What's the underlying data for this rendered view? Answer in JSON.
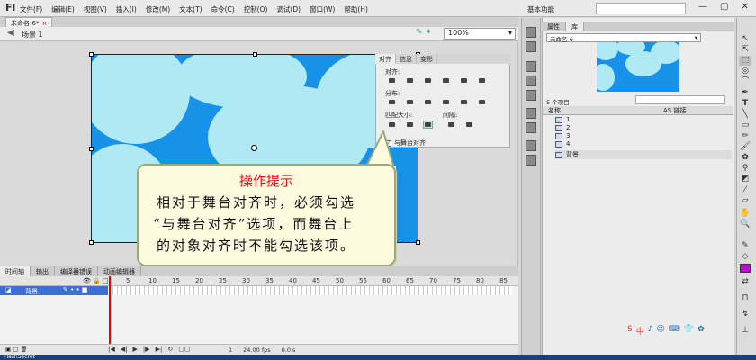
{
  "app": {
    "logo": "Fl",
    "workspace": "基本功能",
    "window_buttons": [
      "—",
      "▢",
      "✕"
    ]
  },
  "menus": [
    "文件(F)",
    "编辑(E)",
    "视图(V)",
    "插入(I)",
    "修改(M)",
    "文本(T)",
    "命令(C)",
    "控制(O)",
    "调试(D)",
    "窗口(W)",
    "帮助(H)"
  ],
  "document": {
    "tab": "未命名-6*",
    "tab_close": "×",
    "scene": "场景 1",
    "zoom": "100%"
  },
  "align_panel": {
    "tabs": [
      "对齐",
      "信息",
      "变形"
    ],
    "sections": {
      "align": "对齐:",
      "distribute": "分布:",
      "match_size": "匹配大小:",
      "spacing": "间隔:"
    },
    "stage_checkbox": "与舞台对齐",
    "stage_checked": true
  },
  "hint": {
    "title": "操作提示",
    "lines": [
      "相对于舞台对齐时，必须勾选",
      "“与舞台对齐”选项，而舞台上",
      "的对象对齐时不能勾选该项。"
    ]
  },
  "timeline": {
    "tabs": [
      "时间轴",
      "输出",
      "编译器错误",
      "动画编辑器"
    ],
    "ticks": [
      "5",
      "10",
      "15",
      "20",
      "25",
      "30",
      "35",
      "40",
      "45",
      "50",
      "55",
      "60",
      "65",
      "70",
      "75",
      "80",
      "85"
    ],
    "layer": "背景",
    "frame": "1",
    "fps": "24.00 fps",
    "time": "0.0 s"
  },
  "library": {
    "tabs": [
      "属性",
      "库"
    ],
    "doc": "未命名-6",
    "count": "5 个项目",
    "columns": [
      "名称",
      "AS 链接"
    ],
    "items": [
      "1",
      "2",
      "3",
      "4",
      "背景"
    ]
  },
  "ime_tray": [
    "S",
    "中",
    "♪",
    "☺",
    "⌨",
    "👕",
    "✿"
  ],
  "status": "FlashSecret"
}
